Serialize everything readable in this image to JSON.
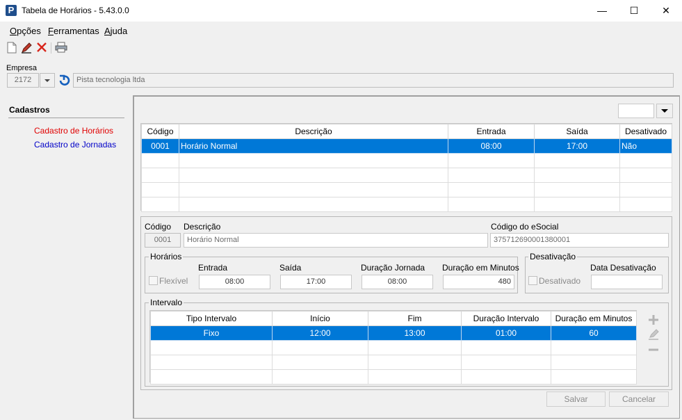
{
  "window": {
    "title": "Tabela de Horários - 5.43.0.0",
    "app_icon": "P",
    "minimize": "—",
    "maximize": "☐",
    "close": "✕"
  },
  "menu": [
    {
      "label": "Opções",
      "underline": "O",
      "rest": "pções"
    },
    {
      "label": "Ferramentas",
      "underline": "F",
      "rest": "erramentas"
    },
    {
      "label": "Ajuda",
      "underline": "A",
      "rest": "juda"
    }
  ],
  "empresa": {
    "label": "Empresa",
    "code": "2172",
    "name": "Pista tecnologia  ltda"
  },
  "sidebar": {
    "title": "Cadastros",
    "items": [
      {
        "label": "Cadastro de Horários",
        "color": "#e00000"
      },
      {
        "label": "Cadastro de Jornadas",
        "color": "#0000c8"
      }
    ]
  },
  "horarios_grid": {
    "columns": [
      "Código",
      "Descrição",
      "Entrada",
      "Saída",
      "Desativado"
    ],
    "rows": [
      {
        "codigo": "0001",
        "descricao": "Horário Normal",
        "entrada": "08:00",
        "saida": "17:00",
        "desativado": "Não"
      }
    ]
  },
  "detail": {
    "codigo_label": "Código",
    "codigo_value": "0001",
    "descricao_label": "Descrição",
    "descricao_value": "Horário Normal",
    "esocial_label": "Código do eSocial",
    "esocial_value": "375712690001380001"
  },
  "horarios": {
    "group_title": "Horários",
    "flexivel_label": "Flexível",
    "entrada_label": "Entrada",
    "entrada_value": "08:00",
    "saida_label": "Saída",
    "saida_value": "17:00",
    "duracao_jornada_label": "Duração Jornada",
    "duracao_jornada_value": "08:00",
    "duracao_minutos_label": "Duração em Minutos",
    "duracao_minutos_value": "480"
  },
  "desativacao": {
    "group_title": "Desativação",
    "desativado_label": "Desativado",
    "data_label": "Data Desativação",
    "data_value": ""
  },
  "intervalo": {
    "group_title": "Intervalo",
    "columns": [
      "Tipo Intervalo",
      "Início",
      "Fim",
      "Duração Intervalo",
      "Duração em Minutos"
    ],
    "rows": [
      {
        "tipo": "Fixo",
        "inicio": "12:00",
        "fim": "13:00",
        "duracao": "01:00",
        "minutos": "60"
      }
    ]
  },
  "buttons": {
    "salvar": "Salvar",
    "cancelar": "Cancelar"
  }
}
